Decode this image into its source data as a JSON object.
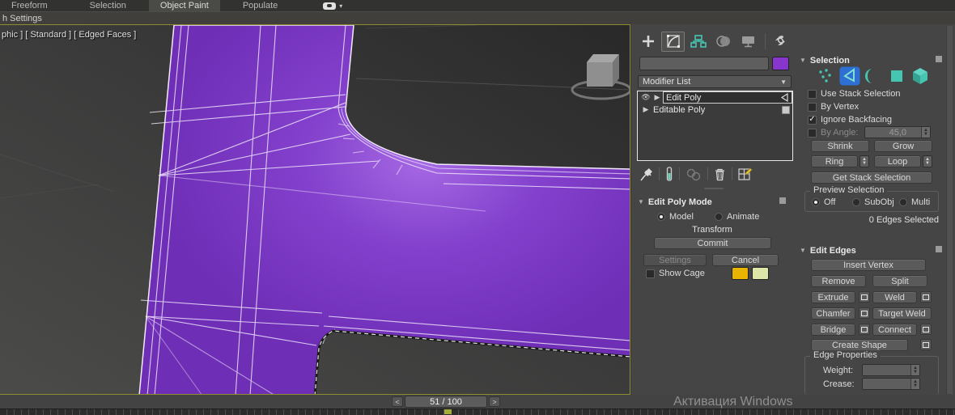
{
  "ribbon": {
    "tabs": [
      {
        "label": "Freeform"
      },
      {
        "label": "Selection"
      },
      {
        "label": "Object Paint"
      },
      {
        "label": "Populate"
      }
    ],
    "row2_label": "h Settings"
  },
  "viewport": {
    "label": "phic ] [ Standard ] [ Edged Faces ]",
    "object_color": "#7c37c6",
    "wire_color": "#eee4fb"
  },
  "command_panel": {
    "object_color_swatch": "#8636cc",
    "modifier_list": {
      "label": "Modifier List"
    },
    "stack": [
      {
        "label": "Edit Poly"
      },
      {
        "label": "Editable Poly"
      }
    ],
    "edit_poly_mode": {
      "title": "Edit Poly Mode",
      "model_label": "Model",
      "animate_label": "Animate",
      "transform_label": "Transform",
      "commit_label": "Commit",
      "settings_label": "Settings",
      "cancel_label": "Cancel",
      "show_cage_label": "Show Cage",
      "cage_color_1": "#e9b400",
      "cage_color_2": "#dde6a6"
    }
  },
  "selection": {
    "title": "Selection",
    "use_stack_selection": "Use Stack Selection",
    "by_vertex": "By Vertex",
    "ignore_backfacing": "Ignore Backfacing",
    "by_angle_label": "By Angle:",
    "by_angle_value": "45,0",
    "shrink_label": "Shrink",
    "grow_label": "Grow",
    "ring_label": "Ring",
    "loop_label": "Loop",
    "get_stack_selection_label": "Get Stack Selection",
    "preview_selection": {
      "title": "Preview Selection",
      "off_label": "Off",
      "subobj_label": "SubObj",
      "multi_label": "Multi"
    },
    "status": "0 Edges Selected"
  },
  "edit_edges": {
    "title": "Edit Edges",
    "insert_vertex_label": "Insert Vertex",
    "remove_label": "Remove",
    "split_label": "Split",
    "extrude_label": "Extrude",
    "weld_label": "Weld",
    "chamfer_label": "Chamfer",
    "target_weld_label": "Target Weld",
    "bridge_label": "Bridge",
    "connect_label": "Connect",
    "create_shape_label": "Create Shape",
    "edge_properties": {
      "title": "Edge Properties",
      "weight_label": "Weight:",
      "crease_label": "Crease:"
    }
  },
  "timeline": {
    "prev_label": "<",
    "frame_label": "51 / 100",
    "next_label": ">"
  },
  "watermark_text": "Активация Windows"
}
